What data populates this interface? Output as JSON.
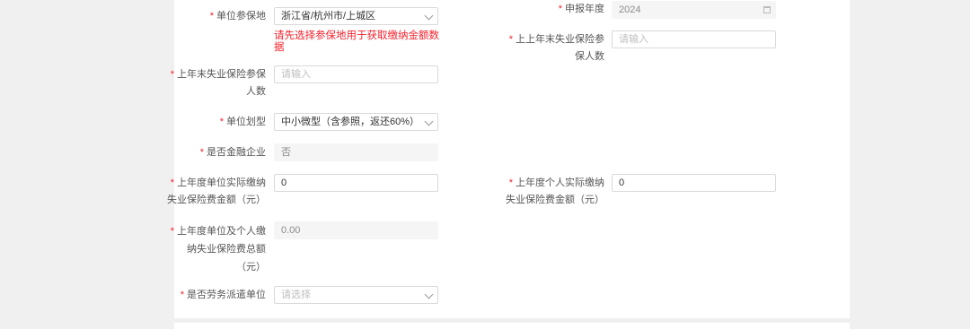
{
  "form": {
    "required_mark": "*",
    "insured_location": {
      "label": "单位参保地",
      "value": "浙江省/杭州市/上城区",
      "error": "请先选择参保地用于获取缴纳金额数据"
    },
    "report_year": {
      "label": "申报年度",
      "value": "2024"
    },
    "prev_prev_year_insured": {
      "label_line1": "上上年末失业保险参",
      "label_line2": "保人数",
      "placeholder": "请输入"
    },
    "prev_year_insured": {
      "label_line1": "上年末失业保险参保",
      "label_line2": "人数",
      "placeholder": "请输入"
    },
    "company_scale": {
      "label": "单位划型",
      "value": "中小微型（含参照，返还60%）"
    },
    "is_financial": {
      "label": "是否金融企业",
      "value": "否"
    },
    "company_paid": {
      "label_line1": "上年度单位实际缴纳",
      "label_line2": "失业保险费金额（元）",
      "value": "0"
    },
    "personal_paid": {
      "label_line1": "上年度个人实际缴纳",
      "label_line2": "失业保险费金额（元）",
      "value": "0"
    },
    "total_paid": {
      "label_line1": "上年度单位及个人缴",
      "label_line2": "纳失业保险费总额",
      "label_line3": "（元）",
      "value": "0.00"
    },
    "labor_dispatch": {
      "label": "是否劳务派遣单位",
      "placeholder": "请选择"
    }
  }
}
